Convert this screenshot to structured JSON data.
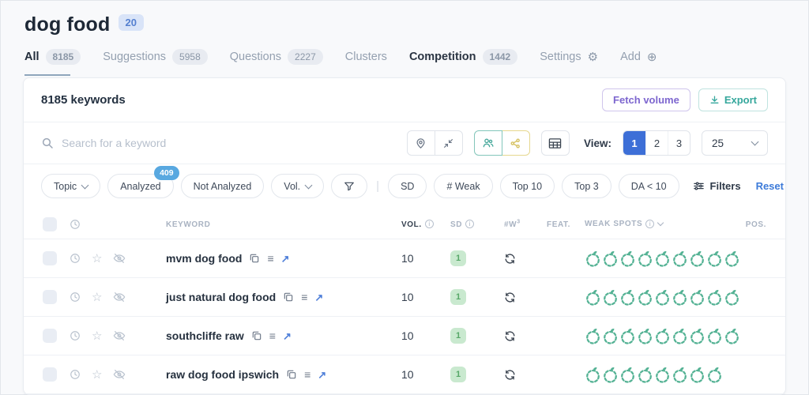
{
  "page": {
    "title": "dog food",
    "title_badge": "20"
  },
  "tabs": [
    {
      "label": "All",
      "count": "8185"
    },
    {
      "label": "Suggestions",
      "count": "5958"
    },
    {
      "label": "Questions",
      "count": "2227"
    },
    {
      "label": "Clusters",
      "count": ""
    },
    {
      "label": "Competition",
      "count": "1442"
    }
  ],
  "tab_extras": {
    "settings": "Settings",
    "add": "Add"
  },
  "glyphs": {
    "gear": "⚙",
    "plus_circle": "⊕",
    "star": "☆",
    "list": "≡",
    "external_arrow": "↗",
    "pipe": "|"
  },
  "card_header": {
    "keywords_count": "8185 keywords",
    "fetch_volume": "Fetch volume",
    "export": "Export"
  },
  "search": {
    "placeholder": "Search for a keyword"
  },
  "view": {
    "label": "View:",
    "options": [
      "1",
      "2",
      "3"
    ],
    "active": "1",
    "page_size": "25"
  },
  "filters": {
    "topic": "Topic",
    "analyzed": "Analyzed",
    "analyzed_badge": "409",
    "not_analyzed": "Not Analyzed",
    "vol": "Vol.",
    "sd": "SD",
    "weak": "# Weak",
    "top10": "Top 10",
    "top3": "Top 3",
    "da": "DA < 10",
    "filters_label": "Filters",
    "reset_label": "Reset"
  },
  "table": {
    "headers": {
      "keyword": "KEYWORD",
      "vol": "VOL.",
      "sd": "SD",
      "w": "#W",
      "w_sup": "3",
      "feat": "FEAT.",
      "weak_spots": "WEAK SPOTS",
      "pos": "POS."
    },
    "rows": [
      {
        "keyword": "mvm dog food",
        "vol": "10",
        "sd": "1",
        "weak_spots": 9
      },
      {
        "keyword": "just natural dog food",
        "vol": "10",
        "sd": "1",
        "weak_spots": 9
      },
      {
        "keyword": "southcliffe raw",
        "vol": "10",
        "sd": "1",
        "weak_spots": 9
      },
      {
        "keyword": "raw dog food ipswich",
        "vol": "10",
        "sd": "1",
        "weak_spots": 8
      }
    ]
  },
  "colors": {
    "accent_blue": "#3d6fd7",
    "teal": "#35a79c",
    "purple": "#7d66cf",
    "share_yellow": "#d6c262",
    "sd_green": "#57a868",
    "fruit_green": "#54b294",
    "badge_blue": "#58a8e0",
    "title_badge_blue": "#5580d0"
  }
}
